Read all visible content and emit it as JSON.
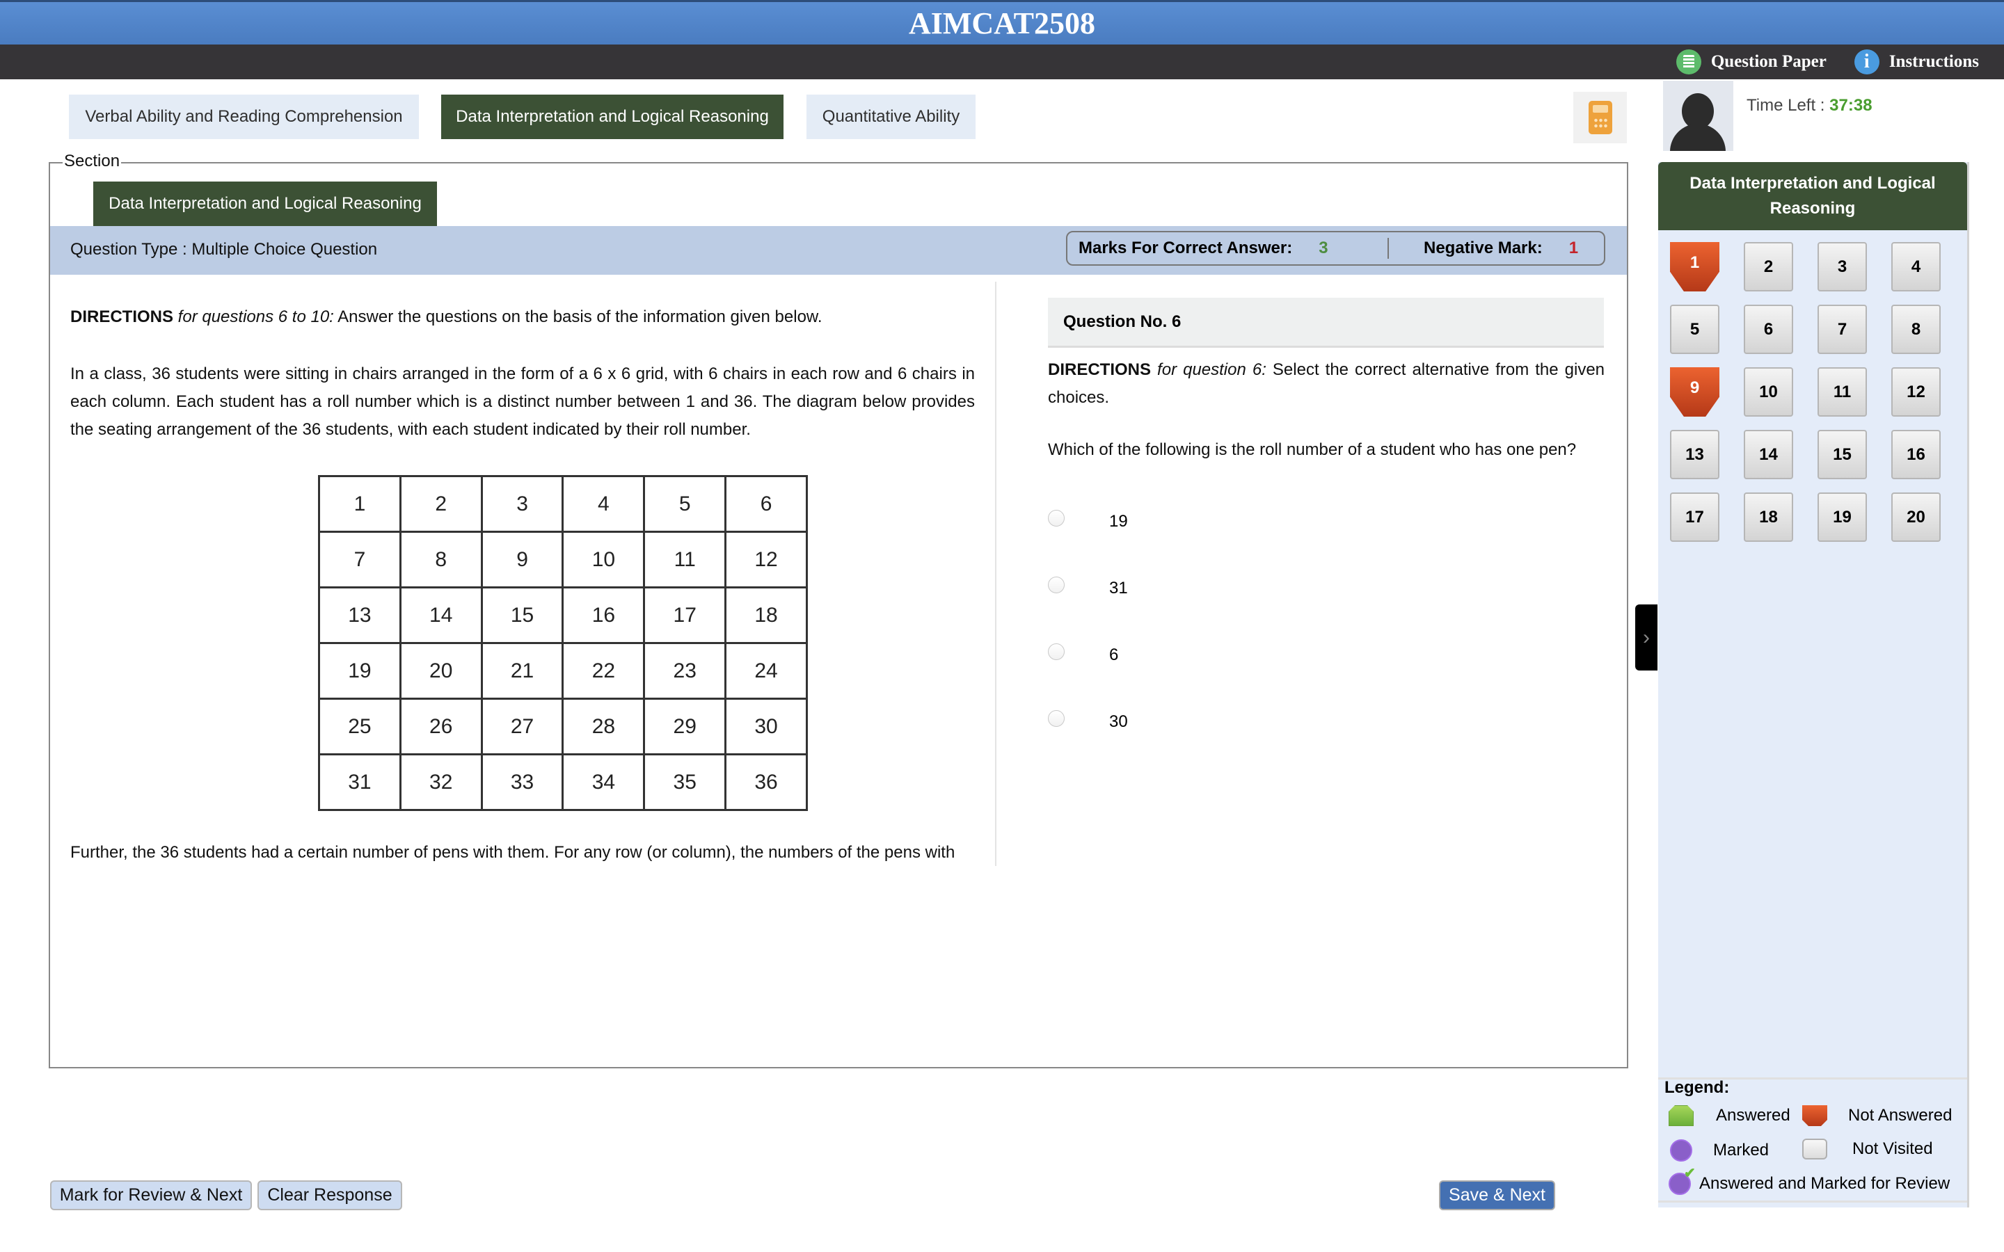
{
  "header": {
    "title": "AIMCAT2508",
    "links": [
      {
        "label": "Question Paper",
        "icon": "question-paper-icon"
      },
      {
        "label": "Instructions",
        "icon": "info-icon"
      }
    ]
  },
  "section_tabs": [
    {
      "label": "Verbal Ability and Reading Comprehension",
      "active": false
    },
    {
      "label": "Data Interpretation and Logical Reasoning",
      "active": true
    },
    {
      "label": "Quantitative Ability",
      "active": false
    }
  ],
  "calculator": {
    "icon": "calculator-icon"
  },
  "candidate": {
    "avatar_icon": "user-silhouette-icon",
    "time_left_label": "Time Left : ",
    "time_left_value": "37:38"
  },
  "section": {
    "legend": "Section",
    "active_tab": "Data Interpretation and Logical Reasoning",
    "question_type": "Question Type : Multiple Choice Question",
    "marks_correct_label": "Marks For Correct Answer:",
    "marks_correct_value": "3",
    "negative_mark_label": "Negative Mark:",
    "negative_mark_value": "1"
  },
  "passage": {
    "directions_bold": "DIRECTIONS",
    "directions_italic": " for questions 6 to 10:",
    "directions_rest": " Answer the questions on the basis of the information given below.",
    "para1": "In a class, 36 students were sitting in chairs arranged in the form of a 6 x 6 grid, with 6 chairs in each row and 6 chairs in each column. Each student has a roll number which is a distinct number between 1 and 36. The diagram below provides the seating arrangement of the 36 students, with each student indicated by their roll number.",
    "grid": [
      [
        "1",
        "2",
        "3",
        "4",
        "5",
        "6"
      ],
      [
        "7",
        "8",
        "9",
        "10",
        "11",
        "12"
      ],
      [
        "13",
        "14",
        "15",
        "16",
        "17",
        "18"
      ],
      [
        "19",
        "20",
        "21",
        "22",
        "23",
        "24"
      ],
      [
        "25",
        "26",
        "27",
        "28",
        "29",
        "30"
      ],
      [
        "31",
        "32",
        "33",
        "34",
        "35",
        "36"
      ]
    ],
    "para2": "Further, the 36 students had a certain number of pens with them. For any row (or column), the numbers of the pens with"
  },
  "question": {
    "number_label": "Question No. 6",
    "directions_bold": "DIRECTIONS",
    "directions_italic": " for question 6:",
    "directions_rest": " Select the correct alternative from the given choices.",
    "text": "Which of the following is the roll number of a student who has one pen?",
    "options": [
      "19",
      "31",
      "6",
      "30"
    ]
  },
  "palette": {
    "header": "Data Interpretation and Logical Reasoning",
    "questions": [
      {
        "n": "1",
        "status": "not-answered"
      },
      {
        "n": "2",
        "status": "not-visited"
      },
      {
        "n": "3",
        "status": "not-visited"
      },
      {
        "n": "4",
        "status": "not-visited"
      },
      {
        "n": "5",
        "status": "not-visited"
      },
      {
        "n": "6",
        "status": "not-visited"
      },
      {
        "n": "7",
        "status": "not-visited"
      },
      {
        "n": "8",
        "status": "not-visited"
      },
      {
        "n": "9",
        "status": "not-answered"
      },
      {
        "n": "10",
        "status": "not-visited"
      },
      {
        "n": "11",
        "status": "not-visited"
      },
      {
        "n": "12",
        "status": "not-visited"
      },
      {
        "n": "13",
        "status": "not-visited"
      },
      {
        "n": "14",
        "status": "not-visited"
      },
      {
        "n": "15",
        "status": "not-visited"
      },
      {
        "n": "16",
        "status": "not-visited"
      },
      {
        "n": "17",
        "status": "not-visited"
      },
      {
        "n": "18",
        "status": "not-visited"
      },
      {
        "n": "19",
        "status": "not-visited"
      },
      {
        "n": "20",
        "status": "not-visited"
      }
    ],
    "legend_title": "Legend:",
    "legend": {
      "answered": "Answered",
      "not_answered": "Not Answered",
      "marked": "Marked",
      "not_visited": "Not Visited",
      "answered_marked": "Answered and Marked for Review"
    }
  },
  "buttons": {
    "mark_review": "Mark for Review & Next",
    "clear": "Clear Response",
    "save_next": "Save & Next"
  },
  "colors": {
    "header_blue": "#4a7cc0",
    "dark_bar": "#363437",
    "section_green": "#3c5135",
    "timer_green": "#4a9d2f",
    "negative_red": "#c4232a",
    "not_answered_orange": "#d9502a",
    "save_blue": "#4470b2"
  }
}
